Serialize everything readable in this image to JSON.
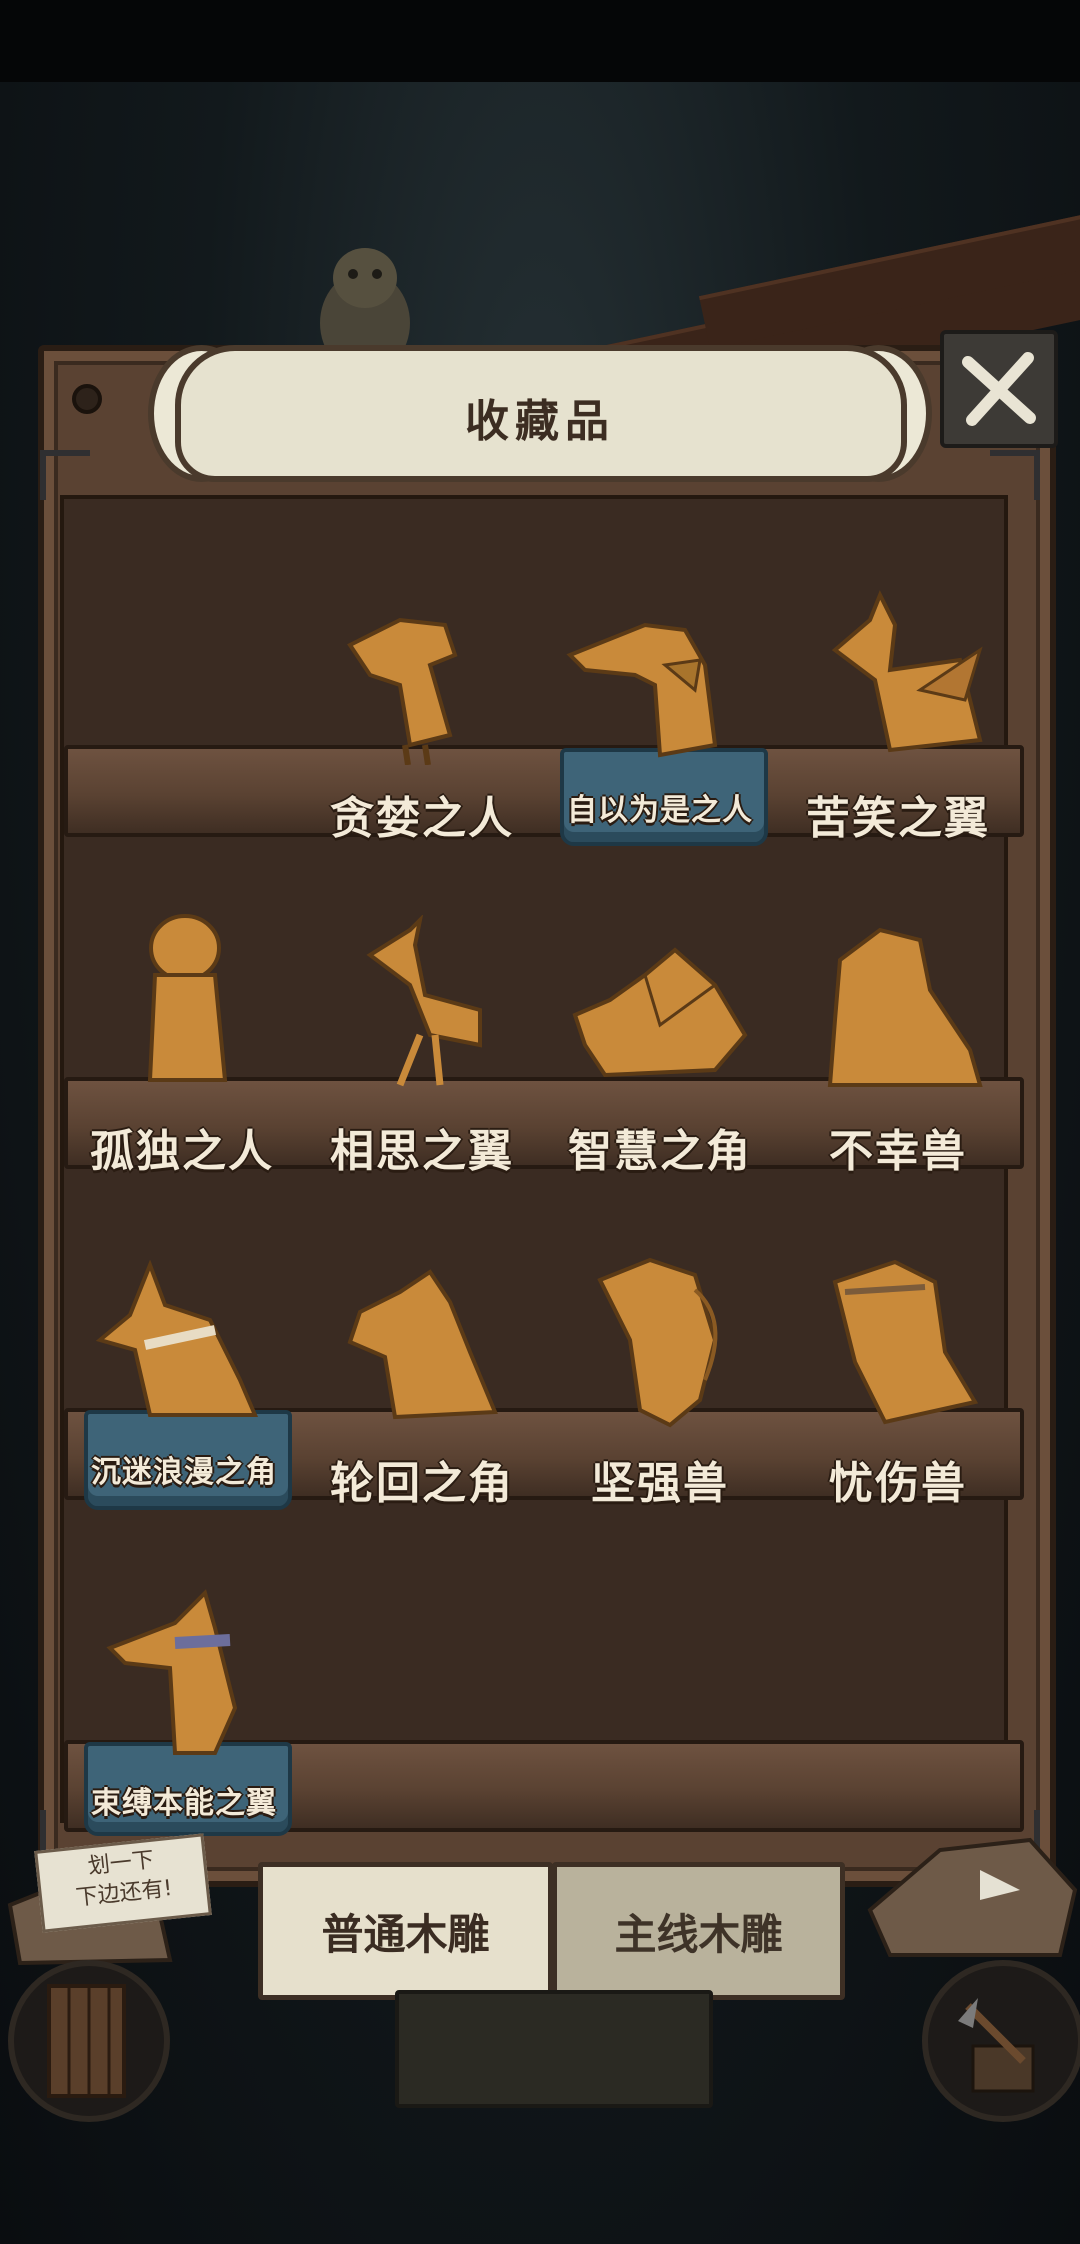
{
  "banner": {
    "title": "收藏品"
  },
  "shelves": [
    {
      "items": [
        {
          "name": "贪婪之人",
          "highlight": false
        },
        {
          "name": "自以为是之人",
          "highlight": true
        },
        {
          "name": "苦笑之翼",
          "highlight": false
        }
      ]
    },
    {
      "items": [
        {
          "name": "孤独之人",
          "highlight": false
        },
        {
          "name": "相思之翼",
          "highlight": false
        },
        {
          "name": "智慧之角",
          "highlight": false
        },
        {
          "name": "不幸兽",
          "highlight": false
        }
      ]
    },
    {
      "items": [
        {
          "name": "沉迷浪漫之角",
          "highlight": true
        },
        {
          "name": "轮回之角",
          "highlight": false
        },
        {
          "name": "坚强兽",
          "highlight": false
        },
        {
          "name": "忧伤兽",
          "highlight": false
        }
      ]
    },
    {
      "items": [
        {
          "name": "束缚本能之翼",
          "highlight": true
        }
      ]
    }
  ],
  "scroll_hint": {
    "line1": "划一下",
    "line2": "下边还有!"
  },
  "tabs": {
    "normal": "普通木雕",
    "main": "主线木雕",
    "active": "normal"
  },
  "colors": {
    "wood": "#5a4232",
    "carving": "#c98a3a",
    "label": "#f3ead8",
    "highlight_ice": "#3e6478"
  }
}
